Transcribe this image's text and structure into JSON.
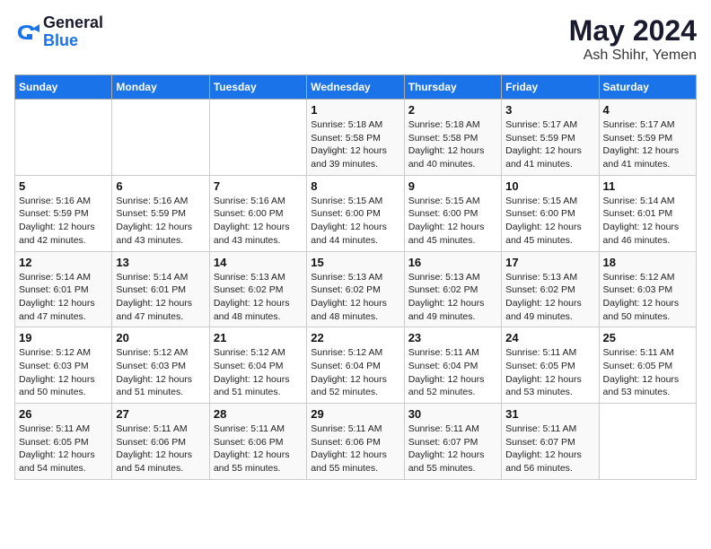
{
  "header": {
    "logo_line1": "General",
    "logo_line2": "Blue",
    "month_year": "May 2024",
    "location": "Ash Shihr, Yemen"
  },
  "days_of_week": [
    "Sunday",
    "Monday",
    "Tuesday",
    "Wednesday",
    "Thursday",
    "Friday",
    "Saturday"
  ],
  "weeks": [
    [
      {
        "day": "",
        "info": ""
      },
      {
        "day": "",
        "info": ""
      },
      {
        "day": "",
        "info": ""
      },
      {
        "day": "1",
        "info": "Sunrise: 5:18 AM\nSunset: 5:58 PM\nDaylight: 12 hours\nand 39 minutes."
      },
      {
        "day": "2",
        "info": "Sunrise: 5:18 AM\nSunset: 5:58 PM\nDaylight: 12 hours\nand 40 minutes."
      },
      {
        "day": "3",
        "info": "Sunrise: 5:17 AM\nSunset: 5:59 PM\nDaylight: 12 hours\nand 41 minutes."
      },
      {
        "day": "4",
        "info": "Sunrise: 5:17 AM\nSunset: 5:59 PM\nDaylight: 12 hours\nand 41 minutes."
      }
    ],
    [
      {
        "day": "5",
        "info": "Sunrise: 5:16 AM\nSunset: 5:59 PM\nDaylight: 12 hours\nand 42 minutes."
      },
      {
        "day": "6",
        "info": "Sunrise: 5:16 AM\nSunset: 5:59 PM\nDaylight: 12 hours\nand 43 minutes."
      },
      {
        "day": "7",
        "info": "Sunrise: 5:16 AM\nSunset: 6:00 PM\nDaylight: 12 hours\nand 43 minutes."
      },
      {
        "day": "8",
        "info": "Sunrise: 5:15 AM\nSunset: 6:00 PM\nDaylight: 12 hours\nand 44 minutes."
      },
      {
        "day": "9",
        "info": "Sunrise: 5:15 AM\nSunset: 6:00 PM\nDaylight: 12 hours\nand 45 minutes."
      },
      {
        "day": "10",
        "info": "Sunrise: 5:15 AM\nSunset: 6:00 PM\nDaylight: 12 hours\nand 45 minutes."
      },
      {
        "day": "11",
        "info": "Sunrise: 5:14 AM\nSunset: 6:01 PM\nDaylight: 12 hours\nand 46 minutes."
      }
    ],
    [
      {
        "day": "12",
        "info": "Sunrise: 5:14 AM\nSunset: 6:01 PM\nDaylight: 12 hours\nand 47 minutes."
      },
      {
        "day": "13",
        "info": "Sunrise: 5:14 AM\nSunset: 6:01 PM\nDaylight: 12 hours\nand 47 minutes."
      },
      {
        "day": "14",
        "info": "Sunrise: 5:13 AM\nSunset: 6:02 PM\nDaylight: 12 hours\nand 48 minutes."
      },
      {
        "day": "15",
        "info": "Sunrise: 5:13 AM\nSunset: 6:02 PM\nDaylight: 12 hours\nand 48 minutes."
      },
      {
        "day": "16",
        "info": "Sunrise: 5:13 AM\nSunset: 6:02 PM\nDaylight: 12 hours\nand 49 minutes."
      },
      {
        "day": "17",
        "info": "Sunrise: 5:13 AM\nSunset: 6:02 PM\nDaylight: 12 hours\nand 49 minutes."
      },
      {
        "day": "18",
        "info": "Sunrise: 5:12 AM\nSunset: 6:03 PM\nDaylight: 12 hours\nand 50 minutes."
      }
    ],
    [
      {
        "day": "19",
        "info": "Sunrise: 5:12 AM\nSunset: 6:03 PM\nDaylight: 12 hours\nand 50 minutes."
      },
      {
        "day": "20",
        "info": "Sunrise: 5:12 AM\nSunset: 6:03 PM\nDaylight: 12 hours\nand 51 minutes."
      },
      {
        "day": "21",
        "info": "Sunrise: 5:12 AM\nSunset: 6:04 PM\nDaylight: 12 hours\nand 51 minutes."
      },
      {
        "day": "22",
        "info": "Sunrise: 5:12 AM\nSunset: 6:04 PM\nDaylight: 12 hours\nand 52 minutes."
      },
      {
        "day": "23",
        "info": "Sunrise: 5:11 AM\nSunset: 6:04 PM\nDaylight: 12 hours\nand 52 minutes."
      },
      {
        "day": "24",
        "info": "Sunrise: 5:11 AM\nSunset: 6:05 PM\nDaylight: 12 hours\nand 53 minutes."
      },
      {
        "day": "25",
        "info": "Sunrise: 5:11 AM\nSunset: 6:05 PM\nDaylight: 12 hours\nand 53 minutes."
      }
    ],
    [
      {
        "day": "26",
        "info": "Sunrise: 5:11 AM\nSunset: 6:05 PM\nDaylight: 12 hours\nand 54 minutes."
      },
      {
        "day": "27",
        "info": "Sunrise: 5:11 AM\nSunset: 6:06 PM\nDaylight: 12 hours\nand 54 minutes."
      },
      {
        "day": "28",
        "info": "Sunrise: 5:11 AM\nSunset: 6:06 PM\nDaylight: 12 hours\nand 55 minutes."
      },
      {
        "day": "29",
        "info": "Sunrise: 5:11 AM\nSunset: 6:06 PM\nDaylight: 12 hours\nand 55 minutes."
      },
      {
        "day": "30",
        "info": "Sunrise: 5:11 AM\nSunset: 6:07 PM\nDaylight: 12 hours\nand 55 minutes."
      },
      {
        "day": "31",
        "info": "Sunrise: 5:11 AM\nSunset: 6:07 PM\nDaylight: 12 hours\nand 56 minutes."
      },
      {
        "day": "",
        "info": ""
      }
    ]
  ]
}
